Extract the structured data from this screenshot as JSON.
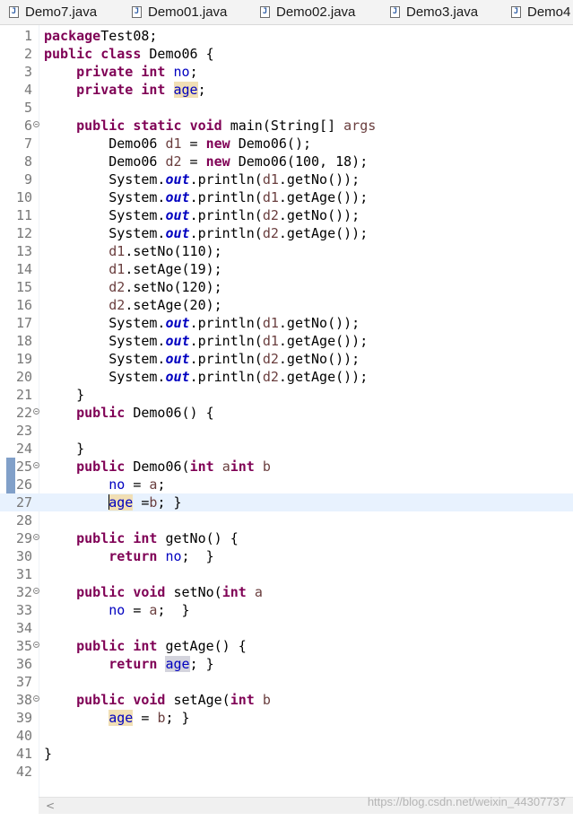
{
  "tabs": [
    {
      "label": "Demo7.java",
      "icon": "java-file-icon"
    },
    {
      "label": "Demo01.java",
      "icon": "java-file-icon"
    },
    {
      "label": "Demo02.java",
      "icon": "java-file-icon"
    },
    {
      "label": "Demo3.java",
      "icon": "java-file-icon"
    },
    {
      "label": "Demo4",
      "icon": "java-file-icon"
    }
  ],
  "editor": {
    "current_line": 27,
    "lines": [
      {
        "n": "1",
        "tokens": [
          [
            "kw",
            "package"
          ],
          [
            "",
            "Test08;"
          ]
        ]
      },
      {
        "n": "2",
        "tokens": [
          [
            "kw",
            "public"
          ],
          [
            "",
            " "
          ],
          [
            "kw",
            "class"
          ],
          [
            "",
            " Demo06 {"
          ]
        ]
      },
      {
        "n": "3",
        "tokens": [
          [
            "",
            "    "
          ],
          [
            "kw",
            "private"
          ],
          [
            "",
            " "
          ],
          [
            "kw",
            "int"
          ],
          [
            "",
            " "
          ],
          [
            "fld",
            "no"
          ],
          [
            "",
            ";"
          ]
        ]
      },
      {
        "n": "4",
        "tokens": [
          [
            "",
            "    "
          ],
          [
            "kw",
            "private"
          ],
          [
            "",
            " "
          ],
          [
            "kw",
            "int"
          ],
          [
            "",
            " "
          ],
          [
            "fld hl",
            "age"
          ],
          [
            "",
            ";"
          ]
        ]
      },
      {
        "n": "5",
        "tokens": []
      },
      {
        "n": "6",
        "fold": true,
        "tokens": [
          [
            "",
            "    "
          ],
          [
            "kw",
            "public"
          ],
          [
            "",
            " "
          ],
          [
            "kw",
            "static"
          ],
          [
            "",
            " "
          ],
          [
            "kw",
            "void"
          ],
          [
            "",
            " main(String[] "
          ],
          [
            "var",
            "args"
          ],
          [
            ") {"
          ]
        ]
      },
      {
        "n": "7",
        "tokens": [
          [
            "",
            "        Demo06 "
          ],
          [
            "var",
            "d1"
          ],
          [
            "",
            " = "
          ],
          [
            "kw",
            "new"
          ],
          [
            "",
            " Demo06();"
          ]
        ]
      },
      {
        "n": "8",
        "tokens": [
          [
            "",
            "        Demo06 "
          ],
          [
            "var",
            "d2"
          ],
          [
            "",
            " = "
          ],
          [
            "kw",
            "new"
          ],
          [
            "",
            " Demo06(100, 18);"
          ]
        ]
      },
      {
        "n": "9",
        "tokens": [
          [
            "",
            "        System."
          ],
          [
            "sfld",
            "out"
          ],
          [
            "",
            ".println("
          ],
          [
            "var",
            "d1"
          ],
          [
            "",
            ".getNo());"
          ]
        ]
      },
      {
        "n": "10",
        "tokens": [
          [
            "",
            "        System."
          ],
          [
            "sfld",
            "out"
          ],
          [
            "",
            ".println("
          ],
          [
            "var",
            "d1"
          ],
          [
            "",
            ".getAge());"
          ]
        ]
      },
      {
        "n": "11",
        "tokens": [
          [
            "",
            "        System."
          ],
          [
            "sfld",
            "out"
          ],
          [
            "",
            ".println("
          ],
          [
            "var",
            "d2"
          ],
          [
            "",
            ".getNo());"
          ]
        ]
      },
      {
        "n": "12",
        "tokens": [
          [
            "",
            "        System."
          ],
          [
            "sfld",
            "out"
          ],
          [
            "",
            ".println("
          ],
          [
            "var",
            "d2"
          ],
          [
            "",
            ".getAge());"
          ]
        ]
      },
      {
        "n": "13",
        "tokens": [
          [
            "",
            "        "
          ],
          [
            "var",
            "d1"
          ],
          [
            "",
            ".setNo(110);"
          ]
        ]
      },
      {
        "n": "14",
        "tokens": [
          [
            "",
            "        "
          ],
          [
            "var",
            "d1"
          ],
          [
            "",
            ".setAge(19);"
          ]
        ]
      },
      {
        "n": "15",
        "tokens": [
          [
            "",
            "        "
          ],
          [
            "var",
            "d2"
          ],
          [
            "",
            ".setNo(120);"
          ]
        ]
      },
      {
        "n": "16",
        "tokens": [
          [
            "",
            "        "
          ],
          [
            "var",
            "d2"
          ],
          [
            "",
            ".setAge(20);"
          ]
        ]
      },
      {
        "n": "17",
        "tokens": [
          [
            "",
            "        System."
          ],
          [
            "sfld",
            "out"
          ],
          [
            "",
            ".println("
          ],
          [
            "var",
            "d1"
          ],
          [
            "",
            ".getNo());"
          ]
        ]
      },
      {
        "n": "18",
        "tokens": [
          [
            "",
            "        System."
          ],
          [
            "sfld",
            "out"
          ],
          [
            "",
            ".println("
          ],
          [
            "var",
            "d1"
          ],
          [
            "",
            ".getAge());"
          ]
        ]
      },
      {
        "n": "19",
        "tokens": [
          [
            "",
            "        System."
          ],
          [
            "sfld",
            "out"
          ],
          [
            "",
            ".println("
          ],
          [
            "var",
            "d2"
          ],
          [
            "",
            ".getNo());"
          ]
        ]
      },
      {
        "n": "20",
        "tokens": [
          [
            "",
            "        System."
          ],
          [
            "sfld",
            "out"
          ],
          [
            "",
            ".println("
          ],
          [
            "var",
            "d2"
          ],
          [
            "",
            ".getAge());"
          ]
        ]
      },
      {
        "n": "21",
        "tokens": [
          [
            "",
            "    }"
          ]
        ]
      },
      {
        "n": "22",
        "fold": true,
        "tokens": [
          [
            "",
            "    "
          ],
          [
            "kw",
            "public"
          ],
          [
            "",
            " Demo06() {"
          ]
        ]
      },
      {
        "n": "23",
        "tokens": []
      },
      {
        "n": "24",
        "tokens": [
          [
            "",
            "    }"
          ]
        ]
      },
      {
        "n": "25",
        "fold": true,
        "mark": true,
        "tokens": [
          [
            "",
            "    "
          ],
          [
            "kw",
            "public"
          ],
          [
            "",
            " Demo06("
          ],
          [
            "kw",
            "int"
          ],
          [
            "",
            " "
          ],
          [
            "var",
            "a"
          ],
          [
            ", "
          ],
          [
            "kw",
            "int"
          ],
          [
            "",
            " "
          ],
          [
            "var",
            "b"
          ],
          [
            ") {"
          ]
        ]
      },
      {
        "n": "26",
        "mark": true,
        "tokens": [
          [
            "",
            "        "
          ],
          [
            "fld",
            "no"
          ],
          [
            "",
            " = "
          ],
          [
            "var",
            "a"
          ],
          [
            "",
            ";"
          ]
        ]
      },
      {
        "n": "27",
        "mark": true,
        "caret": true,
        "tokens": [
          [
            "",
            "        "
          ],
          [
            "caret",
            ""
          ],
          [
            "fld hl",
            "age"
          ],
          [
            "",
            " ="
          ],
          [
            "var",
            "b"
          ],
          [
            "",
            "; }"
          ]
        ]
      },
      {
        "n": "28",
        "tokens": []
      },
      {
        "n": "29",
        "fold": true,
        "tokens": [
          [
            "",
            "    "
          ],
          [
            "kw",
            "public"
          ],
          [
            "",
            " "
          ],
          [
            "kw",
            "int"
          ],
          [
            "",
            " getNo() {"
          ]
        ]
      },
      {
        "n": "30",
        "tokens": [
          [
            "",
            "        "
          ],
          [
            "kw",
            "return"
          ],
          [
            "",
            " "
          ],
          [
            "fld",
            "no"
          ],
          [
            "",
            ";  }"
          ]
        ]
      },
      {
        "n": "31",
        "tokens": []
      },
      {
        "n": "32",
        "fold": true,
        "tokens": [
          [
            "",
            "    "
          ],
          [
            "kw",
            "public"
          ],
          [
            "",
            " "
          ],
          [
            "kw",
            "void"
          ],
          [
            "",
            " setNo("
          ],
          [
            "kw",
            "int"
          ],
          [
            "",
            " "
          ],
          [
            "var",
            "a"
          ],
          [
            ") {"
          ]
        ]
      },
      {
        "n": "33",
        "tokens": [
          [
            "",
            "        "
          ],
          [
            "fld",
            "no"
          ],
          [
            "",
            " = "
          ],
          [
            "var",
            "a"
          ],
          [
            "",
            ";  }"
          ]
        ]
      },
      {
        "n": "34",
        "tokens": []
      },
      {
        "n": "35",
        "fold": true,
        "tokens": [
          [
            "",
            "    "
          ],
          [
            "kw",
            "public"
          ],
          [
            "",
            " "
          ],
          [
            "kw",
            "int"
          ],
          [
            "",
            " getAge() {"
          ]
        ]
      },
      {
        "n": "36",
        "tokens": [
          [
            "",
            "        "
          ],
          [
            "kw",
            "return"
          ],
          [
            "",
            " "
          ],
          [
            "fld hl2",
            "age"
          ],
          [
            "",
            "; }"
          ]
        ]
      },
      {
        "n": "37",
        "tokens": []
      },
      {
        "n": "38",
        "fold": true,
        "tokens": [
          [
            "",
            "    "
          ],
          [
            "kw",
            "public"
          ],
          [
            "",
            " "
          ],
          [
            "kw",
            "void"
          ],
          [
            "",
            " setAge("
          ],
          [
            "kw",
            "int"
          ],
          [
            "",
            " "
          ],
          [
            "var",
            "b"
          ],
          [
            ") {"
          ]
        ]
      },
      {
        "n": "39",
        "tokens": [
          [
            "",
            "        "
          ],
          [
            "fld hl",
            "age"
          ],
          [
            "",
            " = "
          ],
          [
            "var",
            "b"
          ],
          [
            "",
            "; }"
          ]
        ]
      },
      {
        "n": "40",
        "tokens": []
      },
      {
        "n": "41",
        "tokens": [
          [
            "",
            "}"
          ]
        ]
      },
      {
        "n": "42",
        "tokens": []
      }
    ]
  },
  "scrollbar": {
    "left_arrow": "<"
  },
  "watermark": "https://blog.csdn.net/weixin_44307737"
}
